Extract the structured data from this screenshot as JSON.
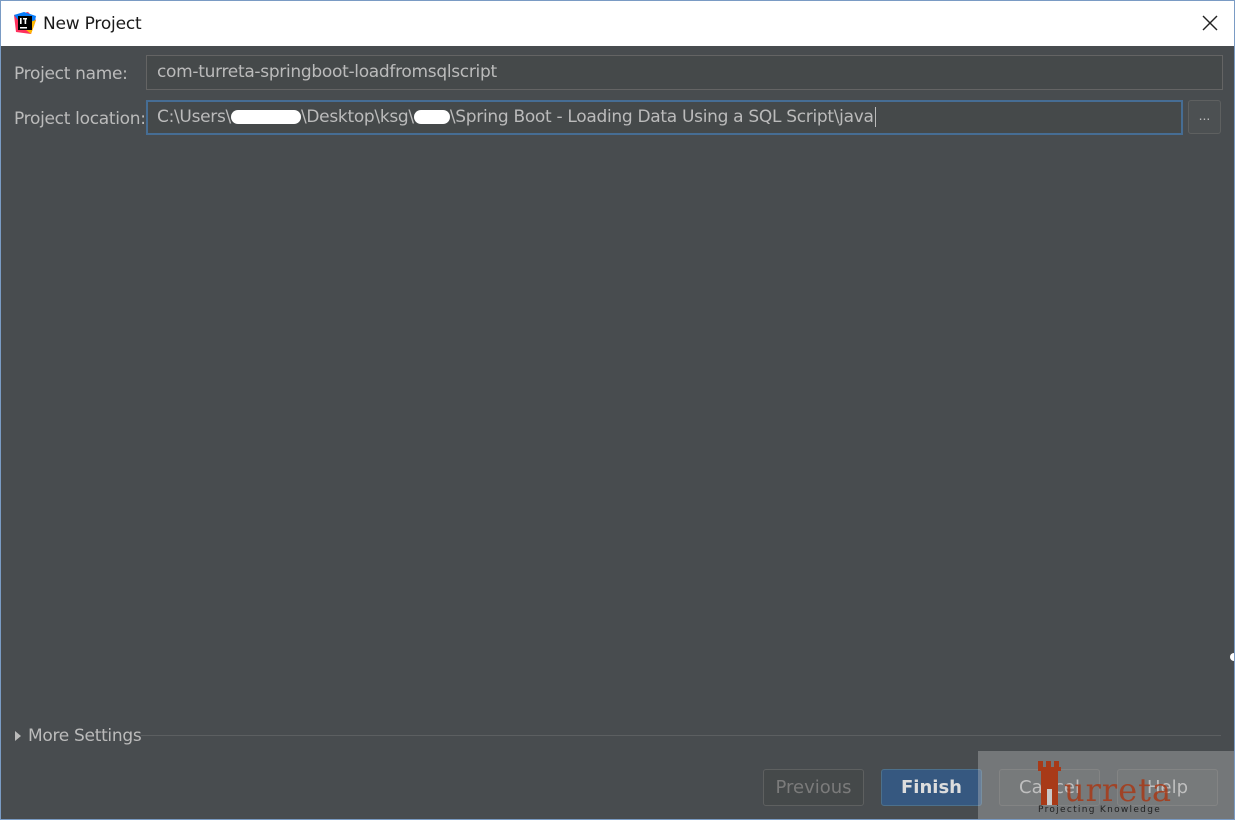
{
  "window": {
    "title": "New Project",
    "app_icon": "intellij-idea-icon",
    "close_icon": "close-icon"
  },
  "form": {
    "project_name_label": "Project name:",
    "project_name_value": "com-turreta-springboot-loadfromsqlscript",
    "project_location_label": "Project location:",
    "project_location_parts": {
      "p1": "C:\\Users\\",
      "p2": "\\Desktop\\ksg\\",
      "p3": "\\Spring Boot - Loading Data Using a SQL Script\\java"
    },
    "browse_label": "..."
  },
  "more_settings": {
    "label": "More Settings",
    "icon": "triangle-right-icon"
  },
  "buttons": {
    "previous": "Previous",
    "finish": "Finish",
    "cancel": "Cancel",
    "help": "Help"
  },
  "watermark": {
    "text": "urreta",
    "subtitle": "Projecting Knowledge"
  },
  "colors": {
    "background": "#484c4f",
    "focus_border": "#466d94",
    "primary_button": "#365880",
    "watermark_brand": "#a83a18"
  }
}
